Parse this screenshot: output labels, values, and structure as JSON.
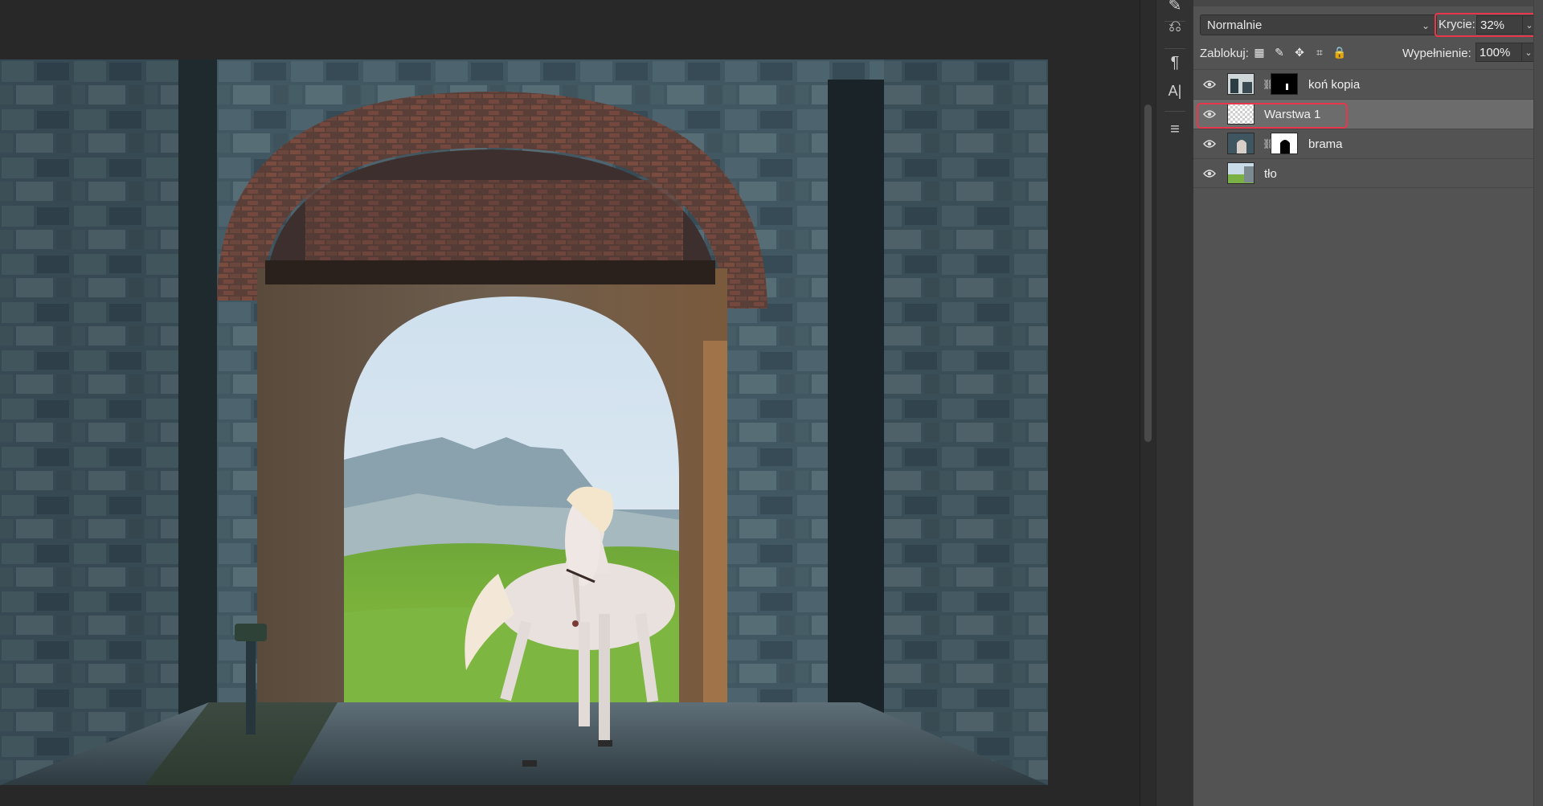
{
  "layers_panel": {
    "blend_mode": "Normalnie",
    "opacity_label": "Krycie:",
    "opacity_value": "32%",
    "lock_label": "Zablokuj:",
    "fill_label": "Wypełnienie:",
    "fill_value": "100%",
    "layers": [
      {
        "name": "koń kopia",
        "visible": true,
        "has_mask": true,
        "selected": false
      },
      {
        "name": "Warstwa 1",
        "visible": true,
        "has_mask": false,
        "selected": true
      },
      {
        "name": "brama",
        "visible": true,
        "has_mask": true,
        "selected": false
      },
      {
        "name": "tło",
        "visible": true,
        "has_mask": false,
        "selected": false
      }
    ]
  },
  "tool_strip": {
    "icons": [
      "brush-settings-icon",
      "history-icon",
      "paragraph-icon",
      "character-icon",
      "adjustments-icon"
    ]
  },
  "colors": {
    "highlight": "#e8364a",
    "panel_bg": "#535353",
    "selected_row": "#6c6c6c"
  }
}
